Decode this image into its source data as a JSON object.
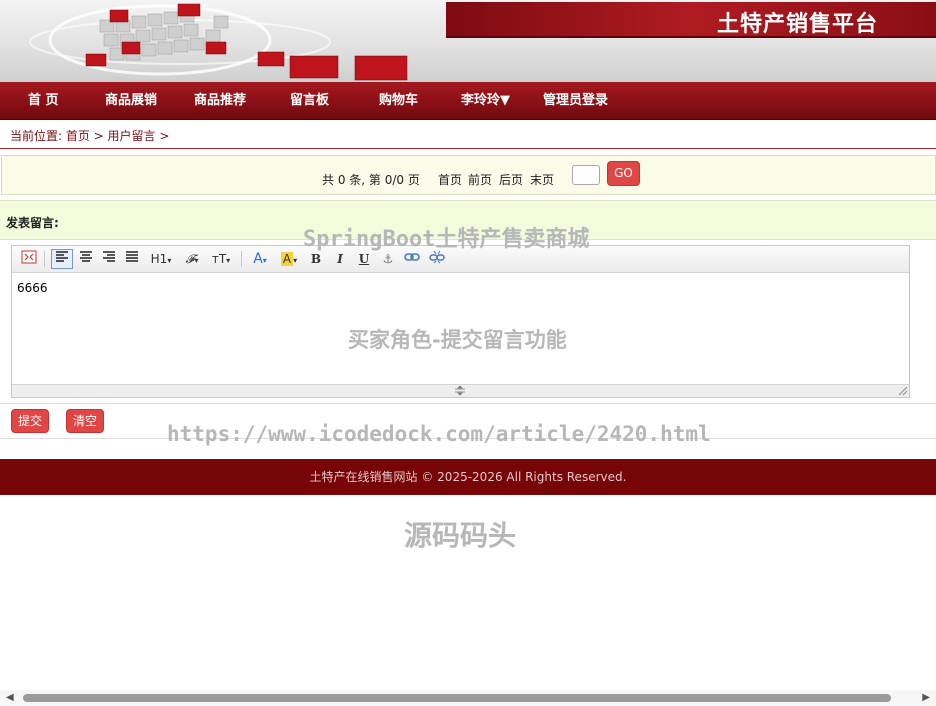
{
  "banner": {
    "site_title": "土特产销售平台"
  },
  "nav": {
    "items": [
      "首 页",
      "商品展销",
      "商品推荐",
      "留言板",
      "购物车",
      "李玲玲▼",
      "管理员登录"
    ]
  },
  "breadcrumb": {
    "text": "当前位置: 首页 > 用户留言 >"
  },
  "pager": {
    "summary": "共 0 条, 第 0/0 页",
    "first": "首页",
    "prev": "前页",
    "next": "后页",
    "last": "末页",
    "page_input_value": "",
    "go_label": "GO"
  },
  "post": {
    "header": "发表留言:",
    "content": "6666",
    "submit_label": "提交",
    "clear_label": "清空"
  },
  "toolbar": {
    "heading": "H1",
    "font_family": "𝓕",
    "font_size": "тT",
    "font_color": "A",
    "bg_color": "A",
    "bold": "B",
    "italic": "I",
    "underline": "U",
    "anchor": "⚓",
    "link": "🔗",
    "unlink": "⛓"
  },
  "footer": {
    "text": "土特产在线销售网站  © 2025-2026 All Rights Reserved."
  },
  "watermarks": {
    "w1": "SpringBoot土特产售卖商城",
    "w2": "买家角色-提交留言功能",
    "w3": "https://www.icodedock.com/article/2420.html",
    "w4": "源码码头"
  },
  "colors": {
    "brand": "#8a1016",
    "button": "#e04646",
    "footer": "#770407"
  }
}
